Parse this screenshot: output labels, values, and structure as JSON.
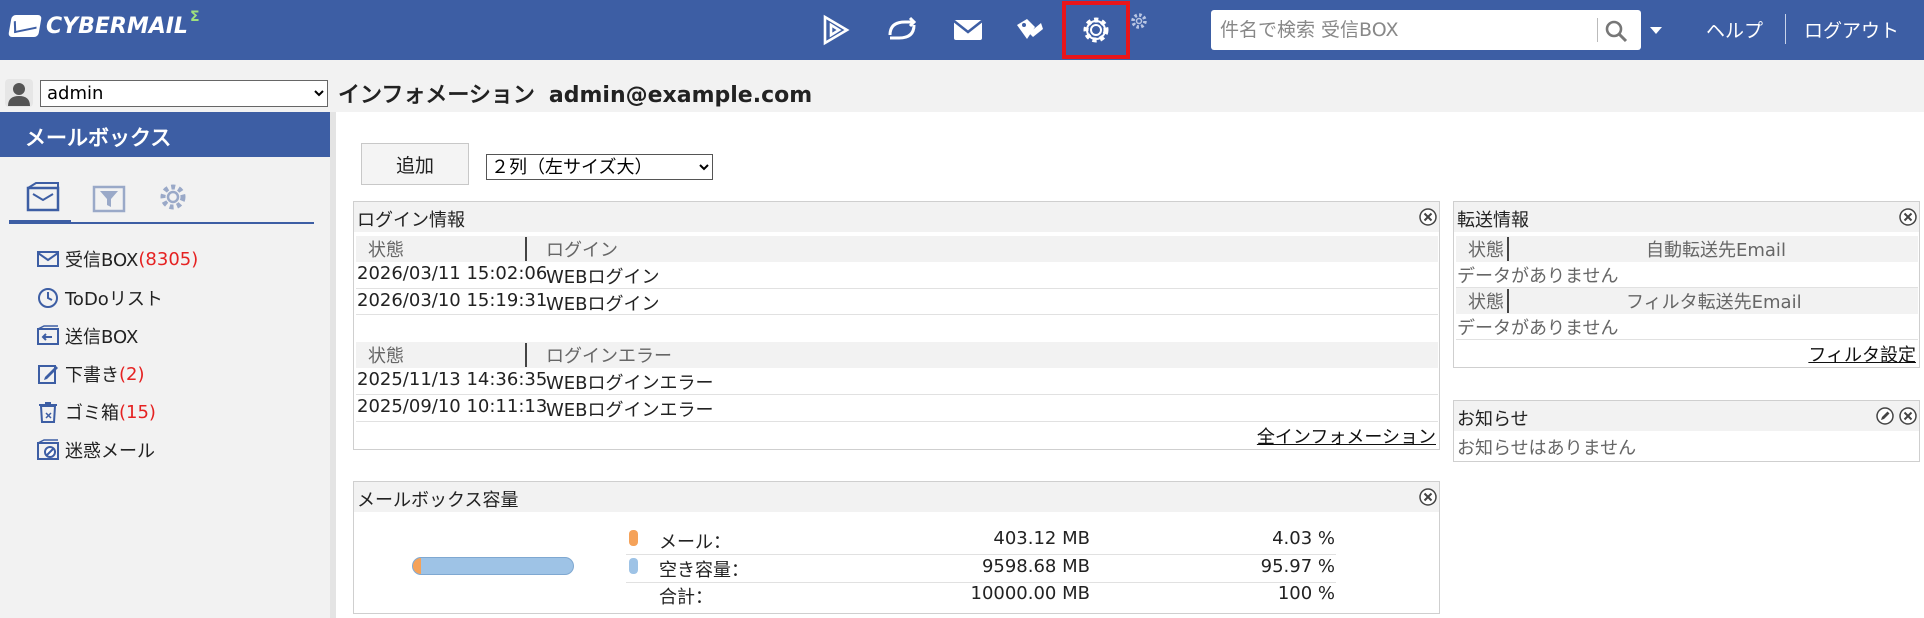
{
  "header": {
    "logo_text": "CYBERMAIL",
    "logo_sup": "Σ",
    "search_placeholder": "件名で検索 受信BOX",
    "help": "ヘルプ",
    "logout": "ログアウト",
    "nav_icons": [
      "portal-icon",
      "sync-icon",
      "mail-icon",
      "tag-icon",
      "gear-icon"
    ]
  },
  "user": {
    "selected": "admin",
    "title": "インフォメーション",
    "email": "admin@example.com"
  },
  "sidebar": {
    "header": "メールボックス",
    "tabs": [
      "mailbox-icon",
      "filter-icon",
      "gear-icon"
    ],
    "folders": [
      {
        "label": "受信BOX",
        "count": "(8305)",
        "icon": "inbox-icon"
      },
      {
        "label": "ToDoリスト",
        "count": "",
        "icon": "clock-icon"
      },
      {
        "label": "送信BOX",
        "count": "",
        "icon": "outbox-icon"
      },
      {
        "label": "下書き",
        "count": "(2)",
        "icon": "draft-icon"
      },
      {
        "label": "ゴミ箱",
        "count": "(15)",
        "icon": "trash-icon"
      },
      {
        "label": "迷惑メール",
        "count": "",
        "icon": "spam-icon"
      }
    ]
  },
  "toolbar": {
    "add": "追加",
    "layout_selected": "２列（左サイズ大）"
  },
  "login_panel": {
    "title": "ログイン情報",
    "col_status": "状態",
    "col_login": "ログイン",
    "login_rows": [
      {
        "date": "2026/03/11 15:02:06",
        "type": "WEBログイン"
      },
      {
        "date": "2026/03/10 15:19:31",
        "type": "WEBログイン"
      }
    ],
    "col_error": "ログインエラー",
    "error_rows": [
      {
        "date": "2025/11/13 14:36:35",
        "type": "WEBログインエラー"
      },
      {
        "date": "2025/09/10 10:11:13",
        "type": "WEBログインエラー"
      }
    ],
    "all_link": "全インフォメーション"
  },
  "forward_panel": {
    "title": "転送情報",
    "col_status": "状態",
    "col_auto": "自動転送先Email",
    "no_data": "データがありません",
    "col_filter": "フィルタ転送先Email",
    "no_data2": "データがありません",
    "filter_link": "フィルタ設定"
  },
  "notice_panel": {
    "title": "お知らせ",
    "empty": "お知らせはありません"
  },
  "quota_panel": {
    "title": "メールボックス容量",
    "used_fraction": 0.0403,
    "rows": [
      {
        "label": "メール：",
        "size": "403.12 MB",
        "pct": "4.03 %",
        "color": "#f5a259"
      },
      {
        "label": "空き容量：",
        "size": "9598.68 MB",
        "pct": "95.97 %",
        "color": "#9ec3e6"
      },
      {
        "label": "合計：",
        "size": "10000.00 MB",
        "pct": "100 %",
        "color": ""
      }
    ]
  }
}
